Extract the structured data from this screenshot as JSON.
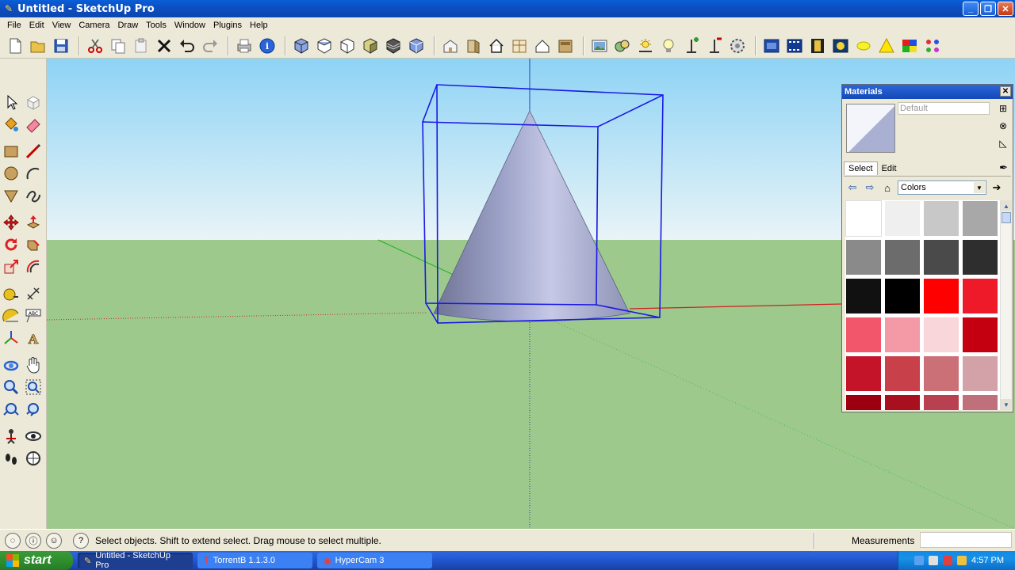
{
  "window": {
    "title": "Untitled - SketchUp Pro",
    "minimize": "_",
    "restore": "❐",
    "close": "✕"
  },
  "menu": [
    "File",
    "Edit",
    "View",
    "Camera",
    "Draw",
    "Tools",
    "Window",
    "Plugins",
    "Help"
  ],
  "toolbar": {
    "icons": [
      "new-icon",
      "open-icon",
      "save-icon",
      "cut-icon",
      "copy-icon",
      "paste-icon",
      "erase-icon",
      "undo-icon",
      "redo-icon",
      "print-icon",
      "model-info-icon",
      "iso-view-icon",
      "top-view-icon",
      "front-view-icon",
      "right-view-icon",
      "back-view-icon",
      "left-view-icon",
      "warehouse-icon",
      "component-icon",
      "house-icon",
      "window-icon",
      "roof-icon",
      "door-icon",
      "photo-textures-icon",
      "styles-icon",
      "shadows-icon",
      "light-icon",
      "add-location-icon",
      "toggle-terrain-icon",
      "settings-icon",
      "layout-icon",
      "scene-icon",
      "film-icon",
      "camera-icon",
      "sun-icon",
      "warning-icon",
      "palette-icon",
      "colors-grid-icon"
    ]
  },
  "left_tools": [
    "select-icon",
    "component-tool-icon",
    "paint-bucket-icon",
    "eraser-icon",
    "rectangle-icon",
    "line-icon",
    "circle-icon",
    "arc-icon",
    "polygon-icon",
    "freehand-icon",
    "move-icon",
    "push-pull-icon",
    "rotate-icon",
    "follow-me-icon",
    "scale-icon",
    "offset-icon",
    "tape-measure-icon",
    "dimension-icon",
    "protractor-icon",
    "text-icon",
    "axes-icon",
    "3d-text-icon",
    "orbit-icon",
    "pan-icon",
    "zoom-icon",
    "zoom-window-icon",
    "zoom-extents-icon",
    "previous-view-icon",
    "position-camera-icon",
    "look-around-icon",
    "walk-icon",
    "section-plane-icon"
  ],
  "materials": {
    "title": "Materials",
    "name_placeholder": "Default",
    "tab_select": "Select",
    "tab_edit": "Edit",
    "category": "Colors",
    "swatches": [
      "#ffffff",
      "#efefef",
      "#c8c8c8",
      "#a8a8a8",
      "#8a8a8a",
      "#6c6c6c",
      "#4a4a4a",
      "#2e2e2e",
      "#111111",
      "#000000",
      "#ff0000",
      "#ee1a2a",
      "#f2566a",
      "#f49aa6",
      "#f9d6da",
      "#c40010",
      "#c4142a",
      "#c8404a",
      "#cc7078",
      "#d2a2a8",
      "#9a0010",
      "#a81020",
      "#b84050",
      "#c0707a"
    ]
  },
  "status": {
    "message": "Select objects. Shift to extend select. Drag mouse to select multiple.",
    "measurements_label": "Measurements"
  },
  "taskbar": {
    "start": "start",
    "tasks": [
      "Untitled - SketchUp Pro",
      "TorrentB 1.1.3.0",
      "HyperCam 3"
    ],
    "clock": "4:57 PM"
  }
}
